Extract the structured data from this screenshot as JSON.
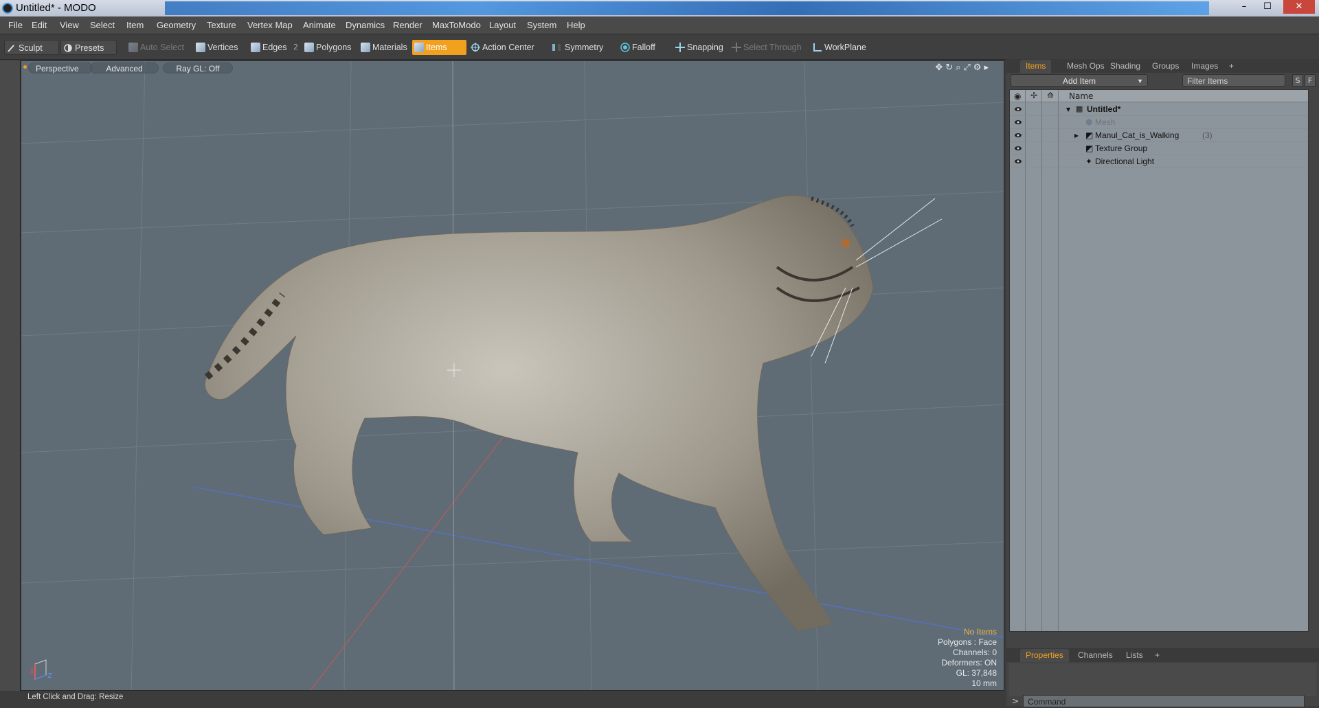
{
  "window": {
    "title": "Untitled* - MODO",
    "minimize": "–",
    "maximize": "☐",
    "close": "✕"
  },
  "menu": [
    "File",
    "Edit",
    "View",
    "Select",
    "Item",
    "Geometry",
    "Texture",
    "Vertex Map",
    "Animate",
    "Dynamics",
    "Render",
    "MaxToModo",
    "Layout",
    "System",
    "Help"
  ],
  "toolbar": {
    "sculpt": "Sculpt",
    "presets": "Presets",
    "auto_select": "Auto Select",
    "vertices": "Vertices",
    "edges": "Edges",
    "edges_count": "2",
    "polygons": "Polygons",
    "materials": "Materials",
    "items": "Items",
    "action_center": "Action Center",
    "symmetry": "Symmetry",
    "falloff": "Falloff",
    "snapping": "Snapping",
    "select_through": "Select Through",
    "workplane": "WorkPlane",
    "accent": "#f2a11f"
  },
  "viewport": {
    "view_mode": "Perspective",
    "shading": "Advanced",
    "raygl": "Ray GL: Off",
    "icons": "✥↻⌕⤢⚙▸",
    "stats": {
      "selection": "No Items",
      "polygons": "Polygons : Face",
      "channels": "Channels: 0",
      "deformers": "Deformers: ON",
      "gl": "GL: 37,848",
      "unit": "10 mm"
    },
    "axis_x": "X",
    "axis_z": "Z"
  },
  "status": {
    "hint": "Left Click and Drag:  Resize"
  },
  "right_panel": {
    "tabs": [
      "Items",
      "Mesh Ops",
      "Shading",
      "Groups",
      "Images",
      "+"
    ],
    "add_item": "Add Item",
    "filter_placeholder": "Filter Items",
    "s_btn": "S",
    "f_btn": "F",
    "column_name": "Name",
    "items": [
      {
        "label": "Untitled*",
        "count": ""
      },
      {
        "label": "Mesh",
        "count": ""
      },
      {
        "label": "Manul_Cat_is_Walking",
        "count": "(3)"
      },
      {
        "label": "Texture Group",
        "count": ""
      },
      {
        "label": "Directional Light",
        "count": ""
      }
    ],
    "bottom_tabs": [
      "Properties",
      "Channels",
      "Lists",
      "+"
    ],
    "command_placeholder": "Command",
    "command_prompt": ">"
  }
}
